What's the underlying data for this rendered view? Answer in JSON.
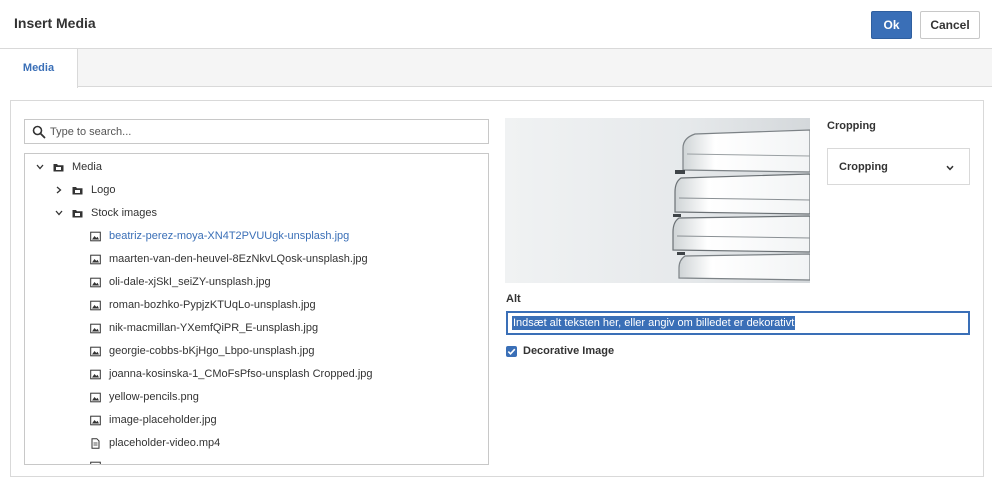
{
  "dialog": {
    "title": "Insert Media",
    "ok_label": "Ok",
    "cancel_label": "Cancel"
  },
  "tabs": [
    {
      "label": "Media",
      "active": true
    }
  ],
  "search": {
    "placeholder": "Type to search...",
    "value": ""
  },
  "tree": [
    {
      "label": "Media",
      "type": "folder",
      "expanded": true,
      "level": 0
    },
    {
      "label": "Logo",
      "type": "folder",
      "expanded": false,
      "level": 1
    },
    {
      "label": "Stock images",
      "type": "folder",
      "expanded": true,
      "level": 1
    },
    {
      "label": "beatriz-perez-moya-XN4T2PVUUgk-unsplash.jpg",
      "type": "image",
      "selected": true,
      "level": 2
    },
    {
      "label": "maarten-van-den-heuvel-8EzNkvLQosk-unsplash.jpg",
      "type": "image",
      "level": 2
    },
    {
      "label": "oli-dale-xjSkI_seiZY-unsplash.jpg",
      "type": "image",
      "level": 2
    },
    {
      "label": "roman-bozhko-PypjzKTUqLo-unsplash.jpg",
      "type": "image",
      "level": 2
    },
    {
      "label": "nik-macmillan-YXemfQiPR_E-unsplash.jpg",
      "type": "image",
      "level": 2
    },
    {
      "label": "georgie-cobbs-bKjHgo_Lbpo-unsplash.jpg",
      "type": "image",
      "level": 2
    },
    {
      "label": "joanna-kosinska-1_CMoFsPfso-unsplash Cropped.jpg",
      "type": "image",
      "level": 2
    },
    {
      "label": "yellow-pencils.png",
      "type": "image",
      "level": 2
    },
    {
      "label": "image-placeholder.jpg",
      "type": "image",
      "level": 2
    },
    {
      "label": "placeholder-video.mp4",
      "type": "file",
      "level": 2
    }
  ],
  "cropping": {
    "label": "Cropping",
    "selected": "Cropping"
  },
  "alt": {
    "label": "Alt",
    "value": "Indsæt alt teksten her, eller angiv om billedet er dekorativt"
  },
  "decorative": {
    "label": "Decorative Image",
    "checked": true
  },
  "colors": {
    "accent": "#3a6fb7",
    "border": "#d9d9d9",
    "tab_bar": "#f5f5f5"
  }
}
